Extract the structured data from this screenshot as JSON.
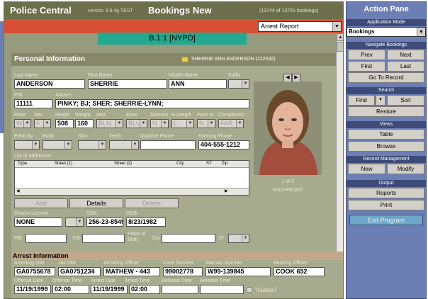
{
  "window": {
    "app_name": "Police Central",
    "version": "version 3.6.4g TEST",
    "module_title": "Bookings New",
    "record_count": "(13744 of 13751 bookings)"
  },
  "report_select": {
    "value": "Arrest Report"
  },
  "cell_label": "B.1:1 [NYPD]",
  "personal": {
    "section_title": "Personal Information",
    "record_name": "SHERRIE ANN ANDERSON (122532)",
    "labels": {
      "last_name": "Last Name",
      "first_name": "First Name",
      "middle_name": "Middle Name",
      "suffix": "Suffix",
      "pin": "PIN",
      "aliases": "Aliases",
      "race": "Race",
      "sex": "Sex",
      "height": "Height",
      "weight": "Weight",
      "hair": "Hair",
      "eyes": "Eyes",
      "glasses": "Glasses",
      "h_length": "H.Length",
      "face_h": "Face H.",
      "complexion": "Complexion",
      "ethnicity": "Ethnicity",
      "build": "Build",
      "skin": "Skin",
      "teeth": "Teeth",
      "daytime_phone": "Daytime Phone",
      "evening_phone": "Evening Phone",
      "addresses": "List of addresses",
      "drivers_license": "Drivers License",
      "ssn": "SSN",
      "dob": "DOB",
      "fbi": "FBI",
      "sid": "SID",
      "place_of_birth": "Place of Birth:",
      "city": "City",
      "st": "ST"
    },
    "values": {
      "last_name": "ANDERSON",
      "first_name": "SHERRIE",
      "middle_name": "ANN",
      "suffix": "",
      "pin": "11111",
      "aliases": "PINKY; BJ; SHER; SHERRIE-LYNN;",
      "race": "W",
      "sex": "F",
      "height": "508",
      "weight": "160",
      "hair": "BLN",
      "eyes": "BLU",
      "glasses": "N",
      "h_length": "L",
      "face_h": "N",
      "complexion": "FAR",
      "evening_phone": "404-555-1212",
      "drivers_license": "NONE",
      "ssn": "256-23-8549",
      "dob": "8/23/1982"
    },
    "address_columns": [
      "Type",
      "Street (1)",
      "Street (2)",
      "City",
      "ST",
      "Zip"
    ],
    "buttons": {
      "add": "Add",
      "details": "Details",
      "delete": "Delete"
    },
    "photo": {
      "index": "1 of 3",
      "source": "MUG-FRONT"
    }
  },
  "arrest": {
    "section_title": "Arrest Information",
    "labels": {
      "arresting_ori": "Arresting ORI",
      "jail_ori": "Jail ORI",
      "arresting_officer": "Arresting Officer",
      "case_number": "Case Number",
      "warrant_number": "Warrant Number",
      "booking_officer": "Booking Officer",
      "offense_date": "Offense Date",
      "offense_time": "Offense Time",
      "arrest_date": "Arrest Date",
      "arrest_time": "Arrest Time",
      "release_date": "Release Date",
      "release_time": "Release Time",
      "trustee": "Trustee?"
    },
    "values": {
      "arresting_ori": "GA0755678",
      "jail_ori": "GA0751234",
      "arresting_officer": "MATHEW - 443",
      "case_number": "99002778",
      "warrant_number": "W99-139845",
      "booking_officer": "COOK 652",
      "offense_date": "11/19/1999",
      "offense_time": "02:00",
      "arrest_date": "11/19/1999",
      "arrest_time": "02:00"
    }
  },
  "action_pane": {
    "title": "Action Pane",
    "application_mode": {
      "header": "Application Mode",
      "value": "Bookings"
    },
    "navigate": {
      "header": "Navigate Bookings",
      "prev": "Prev",
      "next": "Next",
      "first": "First",
      "last": "Last",
      "goto": "Go To Record"
    },
    "search": {
      "header": "Search",
      "find": "Find",
      "sort": "Sort",
      "restore": "Restore"
    },
    "views": {
      "header": "Views",
      "table": "Table",
      "browse": "Browse"
    },
    "record_management": {
      "header": "Record Management",
      "new": "New",
      "modify": "Modify"
    },
    "output": {
      "header": "Output",
      "reports": "Reports",
      "print": "Print"
    },
    "exit": "Exit Program"
  },
  "colors": {
    "title_bar": "#6c6f4b",
    "red_bar": "#d94f35",
    "teal_bar": "#22a98f",
    "action_pane": "#6c7fb5",
    "section_header": "#3e4b78"
  }
}
